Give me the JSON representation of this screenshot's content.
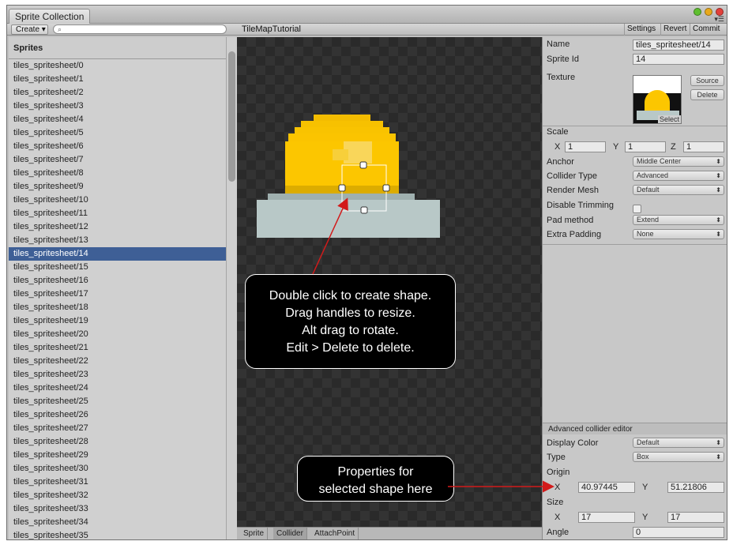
{
  "window": {
    "tab_title": "Sprite Collection"
  },
  "toolbar": {
    "create_label": "Create",
    "collection_title": "TileMapTutorial",
    "settings_label": "Settings",
    "revert_label": "Revert",
    "commit_label": "Commit"
  },
  "sprite_list": {
    "header": "Sprites",
    "selected_index": 14,
    "items": [
      "tiles_spritesheet/0",
      "tiles_spritesheet/1",
      "tiles_spritesheet/2",
      "tiles_spritesheet/3",
      "tiles_spritesheet/4",
      "tiles_spritesheet/5",
      "tiles_spritesheet/6",
      "tiles_spritesheet/7",
      "tiles_spritesheet/8",
      "tiles_spritesheet/9",
      "tiles_spritesheet/10",
      "tiles_spritesheet/11",
      "tiles_spritesheet/12",
      "tiles_spritesheet/13",
      "tiles_spritesheet/14",
      "tiles_spritesheet/15",
      "tiles_spritesheet/16",
      "tiles_spritesheet/17",
      "tiles_spritesheet/18",
      "tiles_spritesheet/19",
      "tiles_spritesheet/20",
      "tiles_spritesheet/21",
      "tiles_spritesheet/22",
      "tiles_spritesheet/23",
      "tiles_spritesheet/24",
      "tiles_spritesheet/25",
      "tiles_spritesheet/26",
      "tiles_spritesheet/27",
      "tiles_spritesheet/28",
      "tiles_spritesheet/29",
      "tiles_spritesheet/30",
      "tiles_spritesheet/31",
      "tiles_spritesheet/32",
      "tiles_spritesheet/33",
      "tiles_spritesheet/34",
      "tiles_spritesheet/35"
    ]
  },
  "callouts": {
    "tooltip_lines": [
      "Double click to create shape.",
      "Drag handles to resize.",
      "Alt drag to rotate.",
      "Edit > Delete to delete."
    ],
    "properties_lines": [
      "Properties for",
      "selected shape here"
    ]
  },
  "canvas_tabs": {
    "sprite": "Sprite",
    "collider": "Collider",
    "attachpoint": "AttachPoint"
  },
  "inspector": {
    "name_label": "Name",
    "name_value": "tiles_spritesheet/14",
    "sprite_id_label": "Sprite Id",
    "sprite_id_value": "14",
    "texture_label": "Texture",
    "source_button": "Source",
    "delete_button": "Delete",
    "select_label": "Select",
    "scale_label": "Scale",
    "x_label": "X",
    "y_label": "Y",
    "z_label": "Z",
    "scale_x": "1",
    "scale_y": "1",
    "scale_z": "1",
    "anchor_label": "Anchor",
    "anchor_value": "Middle Center",
    "collider_type_label": "Collider Type",
    "collider_type_value": "Advanced",
    "render_mesh_label": "Render Mesh",
    "render_mesh_value": "Default",
    "disable_trimming_label": "Disable Trimming",
    "disable_trimming_checked": false,
    "pad_method_label": "Pad method",
    "pad_method_value": "Extend",
    "extra_padding_label": "Extra Padding",
    "extra_padding_value": "None",
    "advanced_header": "Advanced collider editor",
    "display_color_label": "Display Color",
    "display_color_value": "Default",
    "type_label": "Type",
    "type_value": "Box",
    "origin_label": "Origin",
    "origin_x": "40.97445",
    "origin_y": "51.21806",
    "size_label": "Size",
    "size_x": "17",
    "size_y": "17",
    "angle_label": "Angle",
    "angle_value": "0"
  },
  "colors": {
    "selection": "#3e5f96",
    "accent_arrow": "#d21a1a",
    "sprite_yellow": "#f9c300",
    "sprite_base": "#b8c8c7"
  }
}
